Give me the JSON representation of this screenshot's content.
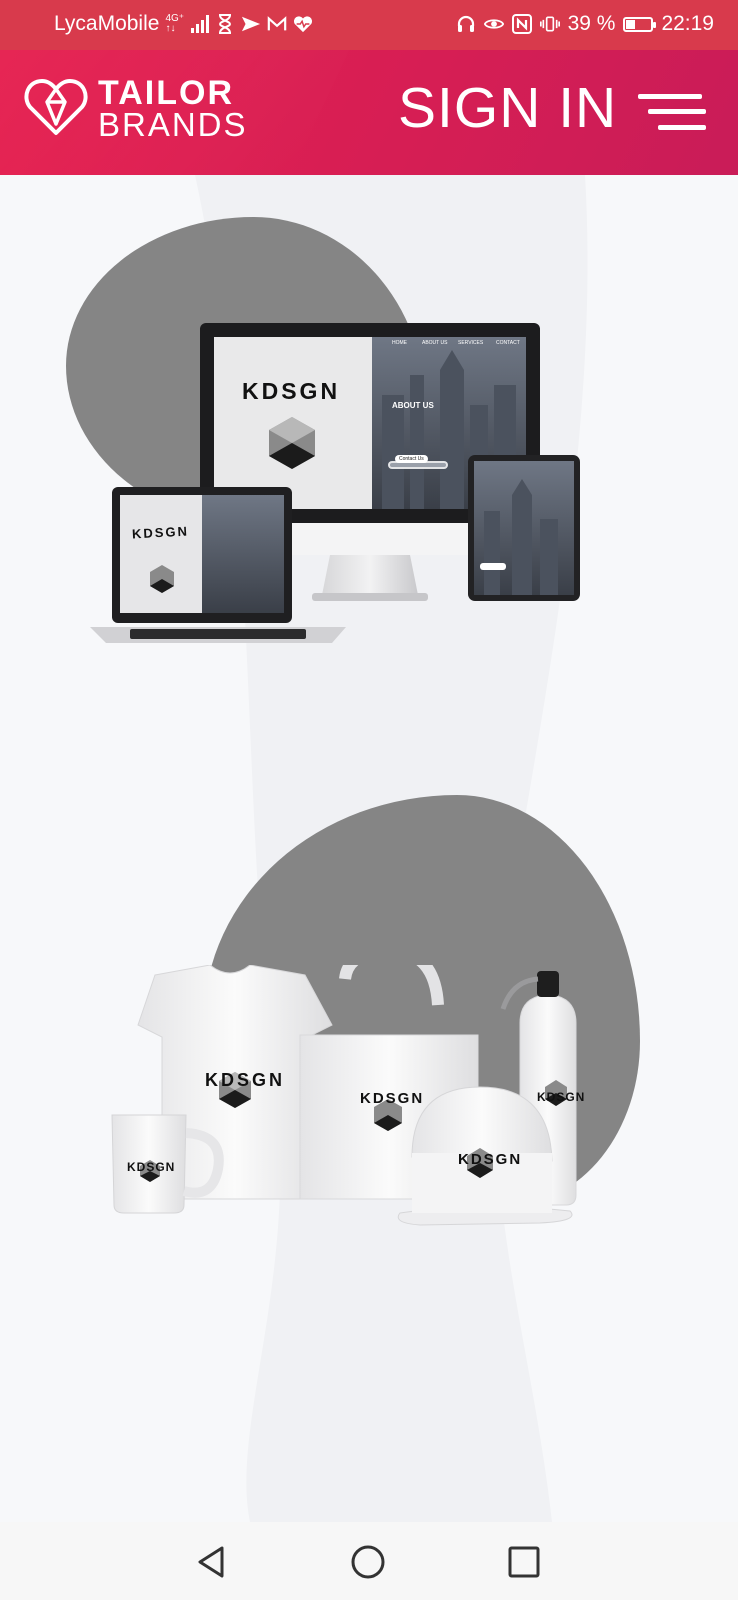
{
  "status_bar": {
    "carrier": "LycaMobile",
    "network_type": "4G⁺",
    "network_sub": "↑↓",
    "battery_percent": "39 %",
    "battery_level": 0.39,
    "time": "22:19"
  },
  "header": {
    "logo_line1": "TAILOR",
    "logo_line2": "BRANDS",
    "sign_in_label": "SIGN IN",
    "brand_color": "#e0194d"
  },
  "showcase": {
    "brand_name": "KDSGN",
    "site_nav": [
      "HOME",
      "ABOUT US",
      "SERVICES",
      "CONTACT"
    ],
    "site_heading": "ABOUT US",
    "site_button": "Contact Us"
  },
  "nav_bar": {
    "back_icon": "back-triangle-icon",
    "home_icon": "home-circle-icon",
    "recents_icon": "recents-square-icon"
  }
}
